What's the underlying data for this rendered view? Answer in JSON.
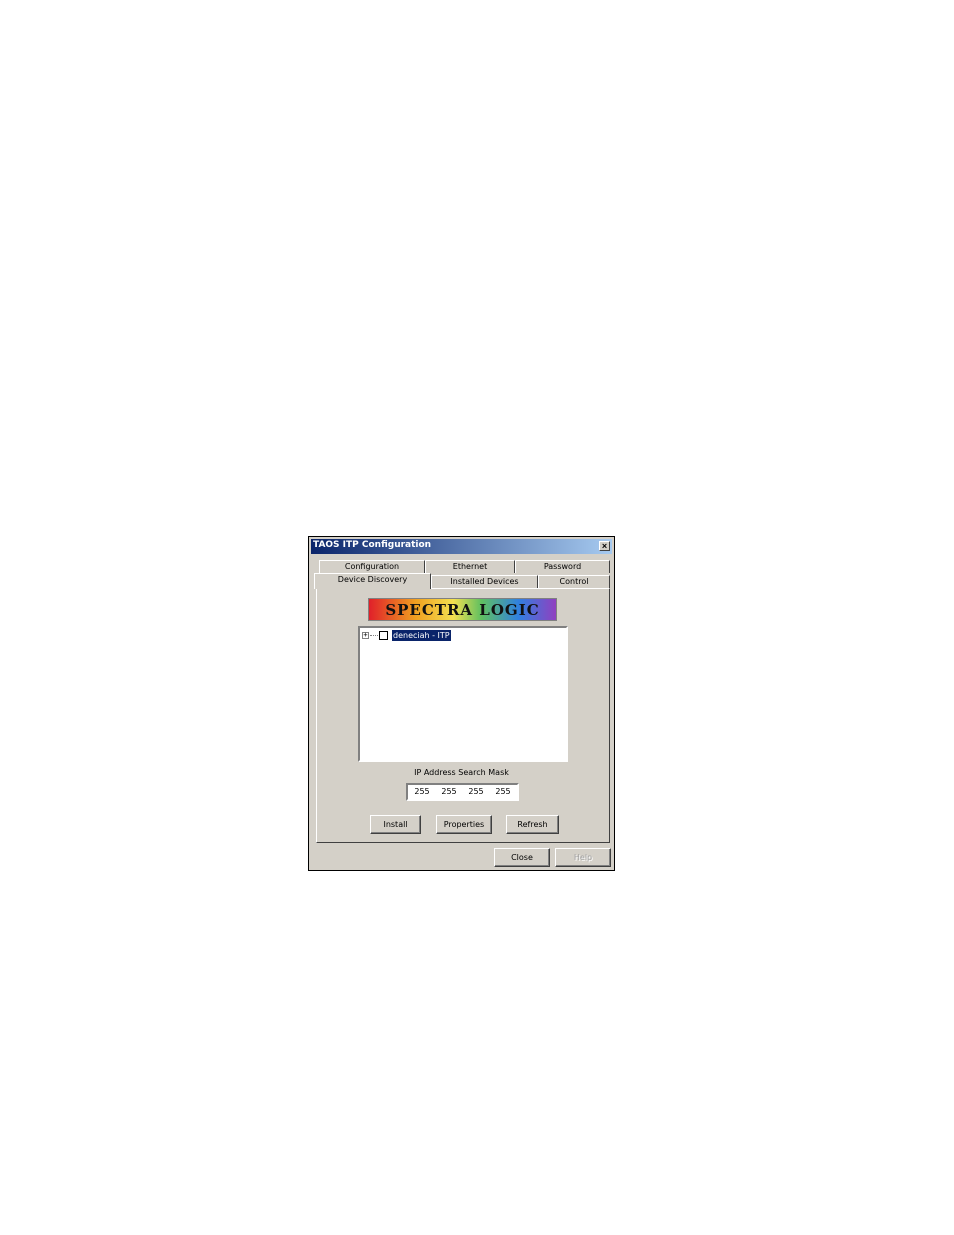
{
  "window": {
    "title": "TAOS ITP Configuration",
    "close_glyph": "×"
  },
  "tabs": {
    "row_back": [
      "Configuration",
      "Ethernet",
      "Password"
    ],
    "row_front": [
      "Device Discovery",
      "Installed Devices",
      "Control"
    ],
    "active": "Device Discovery"
  },
  "logo": {
    "text": "SPECTRA LOGIC"
  },
  "tree": {
    "expander": "+",
    "items": [
      {
        "label": "deneciah - ITP",
        "checked": false,
        "selected": true
      }
    ]
  },
  "ip_mask": {
    "label": "IP Address Search Mask",
    "octets": [
      "255",
      "255",
      "255",
      "255"
    ]
  },
  "buttons": {
    "install": "Install",
    "properties": "Properties",
    "refresh": "Refresh",
    "close": "Close",
    "help": "Help"
  },
  "colors": {
    "dialog_face": "#d4d0c8",
    "titlebar_start": "#0a246a",
    "titlebar_end": "#a6caf0",
    "selection": "#0a246a"
  }
}
